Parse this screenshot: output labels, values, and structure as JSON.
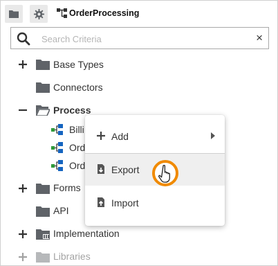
{
  "header": {
    "title": "OrderProcessing",
    "folder_icon": "folder-icon",
    "gear_icon": "gear-icon",
    "crumb_icon": "process-model-icon"
  },
  "search": {
    "placeholder": "Search Criteria",
    "value": "",
    "clear_glyph": "×"
  },
  "tree": {
    "items": [
      {
        "label": "Base Types",
        "toggle": "+",
        "icon": "folder-icon"
      },
      {
        "label": "Connectors",
        "toggle": "",
        "icon": "folder-icon"
      },
      {
        "label": "Process",
        "toggle": "−",
        "icon": "folder-open-icon",
        "expanded": true
      },
      {
        "label": "Billi",
        "icon": "process-icon"
      },
      {
        "label": "Orde",
        "icon": "process-icon"
      },
      {
        "label": "Orde",
        "icon": "process-icon"
      },
      {
        "label": "Forms",
        "toggle": "+",
        "icon": "folder-icon"
      },
      {
        "label": "API",
        "toggle": "",
        "icon": "folder-icon"
      },
      {
        "label": "Implementation",
        "toggle": "+",
        "icon": "folder-icon"
      },
      {
        "label": "Libraries",
        "toggle": "+",
        "icon": "folder-icon",
        "dimmed": true
      }
    ]
  },
  "context_menu": {
    "items": [
      {
        "label": "Add",
        "icon": "plus-icon",
        "submenu": true
      },
      {
        "label": "Export",
        "icon": "export-icon",
        "highlighted": true
      },
      {
        "label": "Import",
        "icon": "import-icon"
      }
    ]
  },
  "colors": {
    "cursor_ring": "#f08a00",
    "icon_gray": "#5f6368",
    "process_blue": "#1565c0",
    "process_green": "#2e9a3a"
  }
}
